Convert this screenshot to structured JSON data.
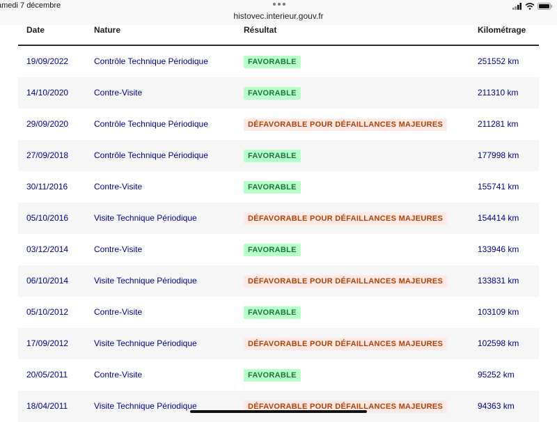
{
  "status_bar": {
    "time_date": "amedi 7 décembre",
    "url": "histovec.interieur.gouv.fr"
  },
  "table": {
    "headers": {
      "date": "Date",
      "nature": "Nature",
      "result": "Résultat",
      "km": "Kilométrage"
    },
    "rows": [
      {
        "date": "19/09/2022",
        "nature": "Contrôle Technique Périodique",
        "result": "FAVORABLE",
        "status": "ok",
        "km": "251552 km"
      },
      {
        "date": "14/10/2020",
        "nature": "Contre-Visite",
        "result": "FAVORABLE",
        "status": "ok",
        "km": "211310 km"
      },
      {
        "date": "29/09/2020",
        "nature": "Contrôle Technique Périodique",
        "result": "DÉFAVORABLE POUR DÉFAILLANCES MAJEURES",
        "status": "ko",
        "km": "211281 km"
      },
      {
        "date": "27/09/2018",
        "nature": "Contrôle Technique Périodique",
        "result": "FAVORABLE",
        "status": "ok",
        "km": "177998 km"
      },
      {
        "date": "30/11/2016",
        "nature": "Contre-Visite",
        "result": "FAVORABLE",
        "status": "ok",
        "km": "155741 km"
      },
      {
        "date": "05/10/2016",
        "nature": "Visite Technique Périodique",
        "result": "DÉFAVORABLE POUR DÉFAILLANCES MAJEURES",
        "status": "ko",
        "km": "154414 km"
      },
      {
        "date": "03/12/2014",
        "nature": "Contre-Visite",
        "result": "FAVORABLE",
        "status": "ok",
        "km": "133946 km"
      },
      {
        "date": "06/10/2014",
        "nature": "Visite Technique Périodique",
        "result": "DÉFAVORABLE POUR DÉFAILLANCES MAJEURES",
        "status": "ko",
        "km": "133831 km"
      },
      {
        "date": "05/10/2012",
        "nature": "Contre-Visite",
        "result": "FAVORABLE",
        "status": "ok",
        "km": "103109 km"
      },
      {
        "date": "17/09/2012",
        "nature": "Visite Technique Périodique",
        "result": "DÉFAVORABLE POUR DÉFAILLANCES MAJEURES",
        "status": "ko",
        "km": "102598 km"
      },
      {
        "date": "20/05/2011",
        "nature": "Contre-Visite",
        "result": "FAVORABLE",
        "status": "ok",
        "km": "95252 km"
      },
      {
        "date": "18/04/2011",
        "nature": "Visite Technique Périodique",
        "result": "DÉFAVORABLE POUR DÉFAILLANCES MAJEURES",
        "status": "ko",
        "km": "94363 km"
      }
    ]
  },
  "colors": {
    "favorable_bg": "#b8fec9",
    "favorable_text": "#18753c",
    "defavorable_bg": "#ffe9e6",
    "defavorable_text": "#b34000",
    "link_text": "#000091"
  },
  "icons": [
    "signal-icon",
    "wifi-icon",
    "battery-icon"
  ]
}
